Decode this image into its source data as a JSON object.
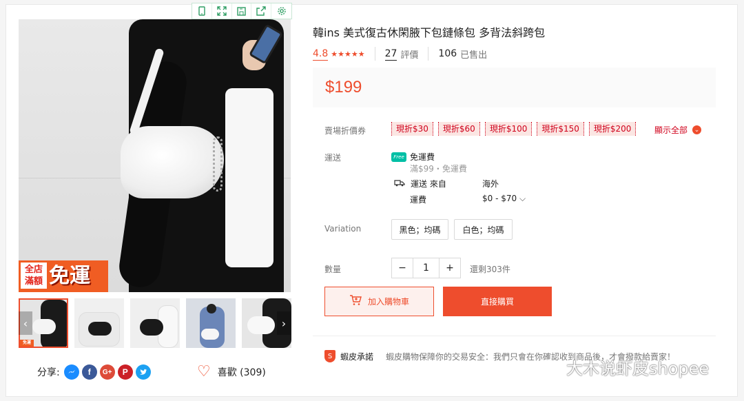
{
  "product": {
    "title": "韓ins 美式復古休閑腋下包鏈條包 多背法斜跨包",
    "rating": "4.8",
    "stars": "★★★★★",
    "reviews_count": "27",
    "reviews_label": "評價",
    "sold_count": "106",
    "sold_label": "已售出",
    "price": "$199"
  },
  "gallery": {
    "promo_line1": "全店",
    "promo_line2": "滿額",
    "promo_big": "免運",
    "prev_arrow": "‹",
    "next_arrow": "›",
    "thumb_promo": "免運"
  },
  "vouchers": {
    "label": "賣場折價券",
    "items": [
      "現折$30",
      "現折$60",
      "現折$100",
      "現折$150",
      "現折$200"
    ],
    "show_all": "顯示全部"
  },
  "shipping": {
    "label": "運送",
    "free_badge": "Free",
    "free_title": "免運費",
    "free_sub": "滿$99・免運費",
    "from_label": "運送 來自",
    "from_value": "海外",
    "fee_label": "運費",
    "fee_value": "$0 - $70"
  },
  "variation": {
    "label": "Variation",
    "options": [
      "黑色；均碼",
      "白色；均碼"
    ]
  },
  "quantity": {
    "label": "數量",
    "minus": "−",
    "value": "1",
    "plus": "+",
    "stock": "還剩303件"
  },
  "actions": {
    "add_to_cart": "加入購物車",
    "buy_now": "直接購買"
  },
  "guarantee": {
    "title": "蝦皮承諾",
    "text": "蝦皮購物保障你的交易安全：我們只會在你確認收到商品後，才會撥款給賣家！"
  },
  "share": {
    "label": "分享:",
    "networks": [
      "messenger-icon",
      "facebook-icon",
      "google-plus-icon",
      "pinterest-icon",
      "twitter-icon"
    ]
  },
  "like": {
    "label": "喜歡 (309)"
  },
  "watermark": "大木说虾皮shopee",
  "colors": {
    "accent": "#ee4d2d",
    "voucher_bg": "#fbe6e3"
  }
}
